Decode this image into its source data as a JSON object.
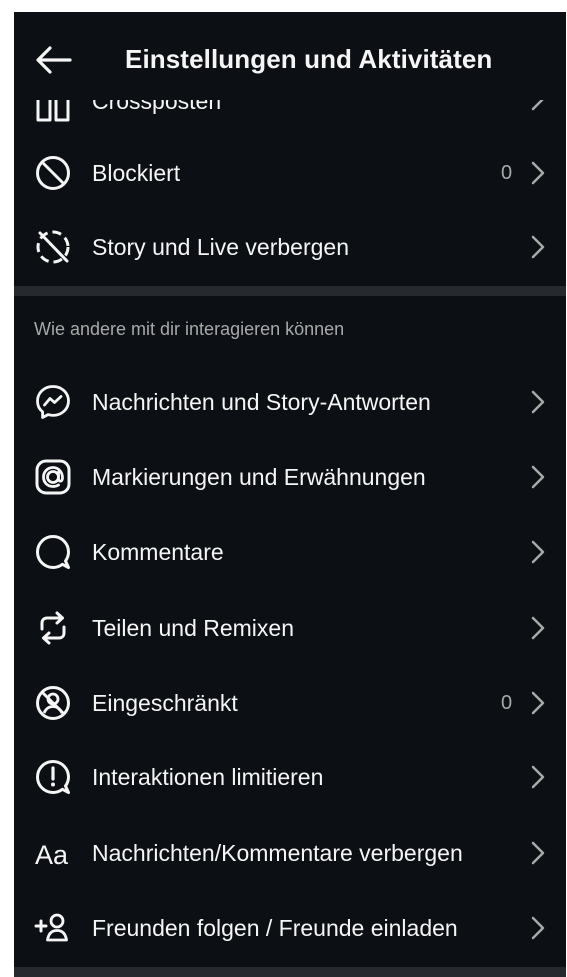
{
  "header": {
    "title": "Einstellungen und Aktivitäten",
    "back_icon": "arrow-left-icon"
  },
  "partial_item": {
    "label": "Crossposten",
    "icon": "crosspost-icon"
  },
  "top_items": [
    {
      "label": "Blockiert",
      "count": "0",
      "icon": "blocked-icon"
    },
    {
      "label": "Story und Live verbergen",
      "count": "",
      "icon": "hide-story-icon"
    }
  ],
  "section": {
    "heading": "Wie andere mit dir interagieren können",
    "items": [
      {
        "label": "Nachrichten und Story-Antworten",
        "count": "",
        "icon": "messenger-icon"
      },
      {
        "label": "Markierungen und Erwähnungen",
        "count": "",
        "icon": "at-sign-icon"
      },
      {
        "label": "Kommentare",
        "count": "",
        "icon": "comment-icon"
      },
      {
        "label": "Teilen und Remixen",
        "count": "",
        "icon": "remix-icon"
      },
      {
        "label": "Eingeschränkt",
        "count": "0",
        "icon": "restricted-icon"
      },
      {
        "label": "Interaktionen limitieren",
        "count": "",
        "icon": "limit-interactions-icon"
      },
      {
        "label": "Nachrichten/Kommentare verbergen",
        "count": "",
        "icon": "hidden-words-icon"
      },
      {
        "label": "Freunden folgen / Freunde einladen",
        "count": "",
        "icon": "add-friend-icon"
      }
    ]
  },
  "glyphs": {
    "hidden_words_icon_text": "Aa"
  },
  "colors": {
    "background": "#0c1014",
    "text": "#f5f5f5",
    "secondary_text": "#a8a8a8",
    "divider": "#262a2f"
  }
}
